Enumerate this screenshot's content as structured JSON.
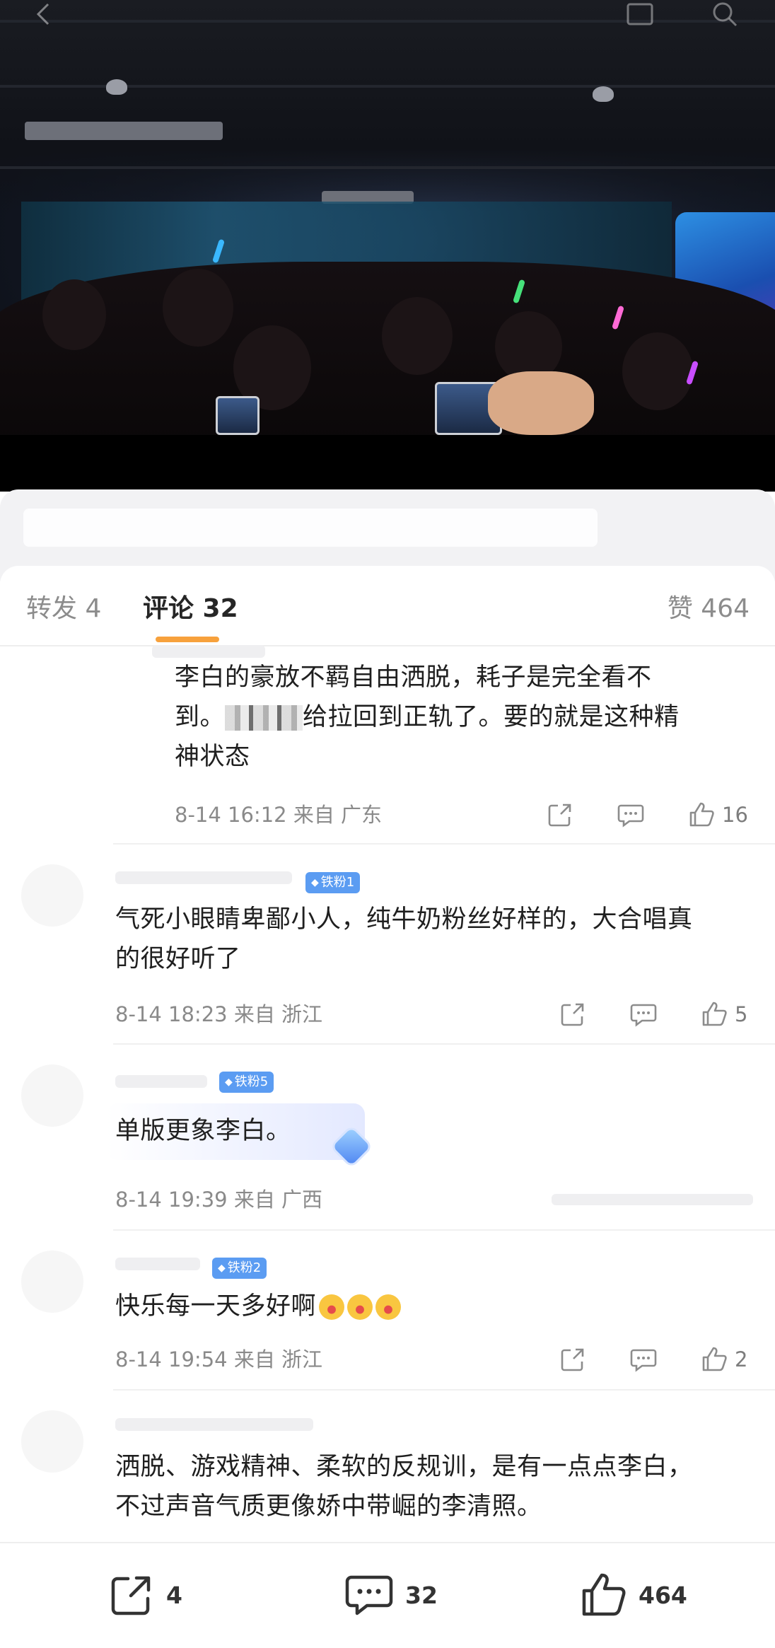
{
  "video": {
    "icons": [
      "back-arrow-icon",
      "picture-in-picture-icon",
      "search-icon"
    ]
  },
  "tabs": {
    "repost": "转发 4",
    "comment": "评论 32",
    "like": "赞 464",
    "active": "comment"
  },
  "comments": [
    {
      "text_line1": "李白的豪放不羁自由洒脱，耗子是完全看不",
      "text_line2_before": "到。",
      "text_line2_after": "给拉回到正轨了。要的就是这种精",
      "text_line3": "神状态",
      "time": "8-14 16:12",
      "location": "来自 广东",
      "likes": "16"
    },
    {
      "badge": "铁粉1",
      "text_line1": "气死小眼睛卑鄙小人，纯牛奶粉丝好样的，大合唱真",
      "text_line2": "的很好听了",
      "time": "8-14 18:23",
      "location": "来自 浙江",
      "likes": "5"
    },
    {
      "badge": "铁粉5",
      "text_line1": "单版更象李白。",
      "time": "8-14 19:39",
      "location": "来自 广西",
      "likes": ""
    },
    {
      "badge": "铁粉2",
      "text_line1": "快乐每一天多好啊",
      "time": "8-14 19:54",
      "location": "来自 浙江",
      "likes": "2"
    },
    {
      "text_line1": "洒脱、游戏精神、柔软的反规训，是有一点点李白，",
      "text_line2": "不过声音气质更像娇中带崛的李清照。"
    }
  ],
  "bottom_bar": {
    "repost_count": "4",
    "comment_count": "32",
    "like_count": "464"
  },
  "colors": {
    "accent_underline": "#f7a13c",
    "badge_blue": "#5b9cf2",
    "meta_grey": "#8a8a8a"
  }
}
